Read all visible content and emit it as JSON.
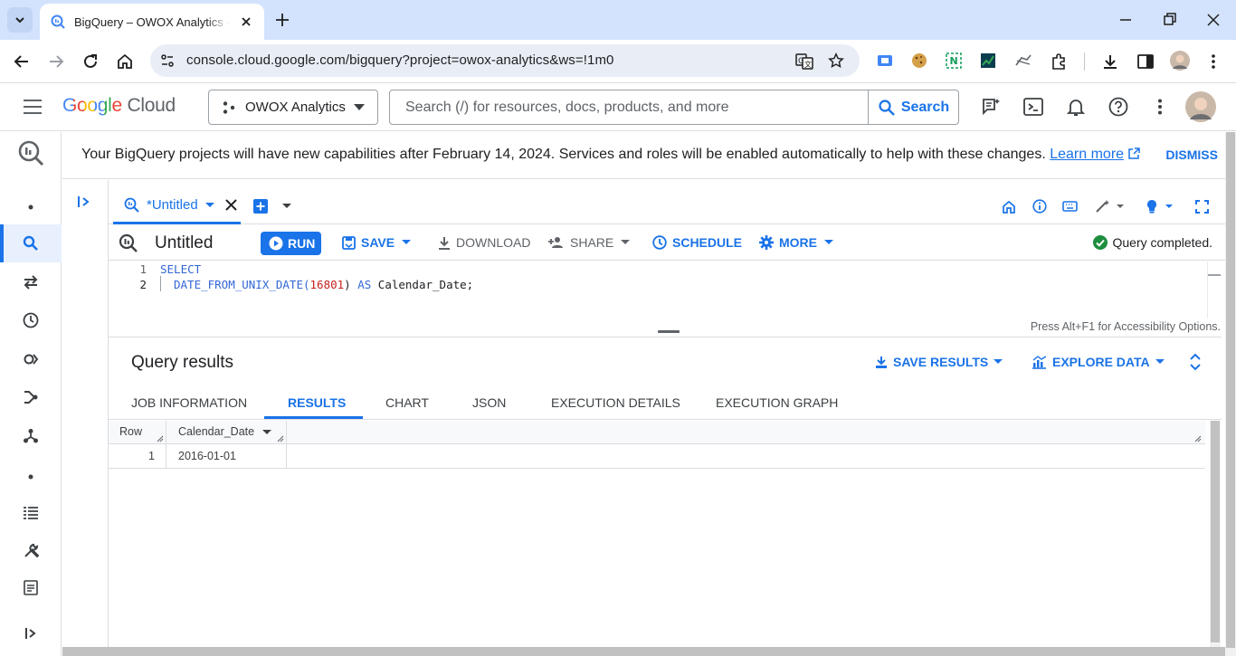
{
  "browser": {
    "tab_title": "BigQuery – OWOX Analytics – Google Cloud console",
    "url": "console.cloud.google.com/bigquery?project=owox-analytics&ws=!1m0"
  },
  "header": {
    "logo_google": "Google",
    "logo_cloud": "Cloud",
    "project_name": "OWOX Analytics",
    "search_placeholder": "Search (/) for resources, docs, products, and more",
    "search_button": "Search"
  },
  "banner": {
    "message": "Your BigQuery projects will have new capabilities after February 14, 2024. Services and roles will be enabled automatically to help with these changes.",
    "learn_more": "Learn more",
    "dismiss": "DISMISS"
  },
  "editor": {
    "tab_label": "*Untitled",
    "query_title": "Untitled",
    "run": "RUN",
    "save": "SAVE",
    "download": "DOWNLOAD",
    "share": "SHARE",
    "schedule": "SCHEDULE",
    "more": "MORE",
    "status": "Query completed.",
    "lines": [
      {
        "n": "1",
        "kw1": "SELECT",
        "fn": "",
        "arg": "",
        "rest": ""
      },
      {
        "n": "2",
        "kw1": "",
        "fn": "DATE_FROM_UNIX_DATE(",
        "arg": "16801",
        "rest": ") AS Calendar_Date;"
      }
    ],
    "line2_as": "AS",
    "accessibility_hint": "Press Alt+F1 for Accessibility Options."
  },
  "results": {
    "title": "Query results",
    "save_results": "SAVE RESULTS",
    "explore_data": "EXPLORE DATA",
    "tabs": [
      "JOB INFORMATION",
      "RESULTS",
      "CHART",
      "JSON",
      "EXECUTION DETAILS",
      "EXECUTION GRAPH"
    ],
    "active_tab": "RESULTS",
    "columns": [
      "Row",
      "Calendar_Date"
    ],
    "rows": [
      [
        "1",
        "2016-01-01"
      ]
    ]
  },
  "colors": {
    "accent": "#1a73e8",
    "tabstrip": "#d3e3fd",
    "success": "#1e8e3e"
  }
}
